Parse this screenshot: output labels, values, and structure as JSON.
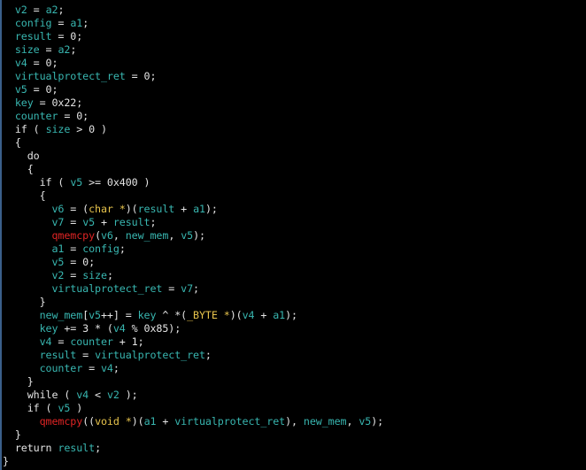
{
  "colors": {
    "identifier": "#38b6b0",
    "plain": "#e4e4e4",
    "type": "#e8c44c",
    "function": "#e02424",
    "background": "#000000"
  },
  "code_lines": [
    [
      [
        "p",
        "  "
      ],
      [
        "v",
        "v2"
      ],
      [
        "p",
        " = "
      ],
      [
        "v",
        "a2"
      ],
      [
        "p",
        ";"
      ]
    ],
    [
      [
        "p",
        "  "
      ],
      [
        "v",
        "config"
      ],
      [
        "p",
        " = "
      ],
      [
        "v",
        "a1"
      ],
      [
        "p",
        ";"
      ]
    ],
    [
      [
        "p",
        "  "
      ],
      [
        "v",
        "result"
      ],
      [
        "p",
        " = 0;"
      ]
    ],
    [
      [
        "p",
        "  "
      ],
      [
        "v",
        "size"
      ],
      [
        "p",
        " = "
      ],
      [
        "v",
        "a2"
      ],
      [
        "p",
        ";"
      ]
    ],
    [
      [
        "p",
        "  "
      ],
      [
        "v",
        "v4"
      ],
      [
        "p",
        " = 0;"
      ]
    ],
    [
      [
        "p",
        "  "
      ],
      [
        "v",
        "virtualprotect_ret"
      ],
      [
        "p",
        " = 0;"
      ]
    ],
    [
      [
        "p",
        "  "
      ],
      [
        "v",
        "v5"
      ],
      [
        "p",
        " = 0;"
      ]
    ],
    [
      [
        "p",
        "  "
      ],
      [
        "v",
        "key"
      ],
      [
        "p",
        " = 0x22;"
      ]
    ],
    [
      [
        "p",
        "  "
      ],
      [
        "v",
        "counter"
      ],
      [
        "p",
        " = 0;"
      ]
    ],
    [
      [
        "p",
        "  if ( "
      ],
      [
        "v",
        "size"
      ],
      [
        "p",
        " > 0 )"
      ]
    ],
    [
      [
        "p",
        "  {"
      ]
    ],
    [
      [
        "p",
        "    do"
      ]
    ],
    [
      [
        "p",
        "    {"
      ]
    ],
    [
      [
        "p",
        "      if ( "
      ],
      [
        "v",
        "v5"
      ],
      [
        "p",
        " >= 0x400 )"
      ]
    ],
    [
      [
        "p",
        "      {"
      ]
    ],
    [
      [
        "p",
        "        "
      ],
      [
        "v",
        "v6"
      ],
      [
        "p",
        " = ("
      ],
      [
        "t",
        "char *"
      ],
      [
        "p",
        ")("
      ],
      [
        "v",
        "result"
      ],
      [
        "p",
        " + "
      ],
      [
        "v",
        "a1"
      ],
      [
        "p",
        ");"
      ]
    ],
    [
      [
        "p",
        "        "
      ],
      [
        "v",
        "v7"
      ],
      [
        "p",
        " = "
      ],
      [
        "v",
        "v5"
      ],
      [
        "p",
        " + "
      ],
      [
        "v",
        "result"
      ],
      [
        "p",
        ";"
      ]
    ],
    [
      [
        "p",
        "        "
      ],
      [
        "f",
        "qmemcpy"
      ],
      [
        "p",
        "("
      ],
      [
        "v",
        "v6"
      ],
      [
        "p",
        ", "
      ],
      [
        "v",
        "new_mem"
      ],
      [
        "p",
        ", "
      ],
      [
        "v",
        "v5"
      ],
      [
        "p",
        ");"
      ]
    ],
    [
      [
        "p",
        "        "
      ],
      [
        "v",
        "a1"
      ],
      [
        "p",
        " = "
      ],
      [
        "v",
        "config"
      ],
      [
        "p",
        ";"
      ]
    ],
    [
      [
        "p",
        "        "
      ],
      [
        "v",
        "v5"
      ],
      [
        "p",
        " = 0;"
      ]
    ],
    [
      [
        "p",
        "        "
      ],
      [
        "v",
        "v2"
      ],
      [
        "p",
        " = "
      ],
      [
        "v",
        "size"
      ],
      [
        "p",
        ";"
      ]
    ],
    [
      [
        "p",
        "        "
      ],
      [
        "v",
        "virtualprotect_ret"
      ],
      [
        "p",
        " = "
      ],
      [
        "v",
        "v7"
      ],
      [
        "p",
        ";"
      ]
    ],
    [
      [
        "p",
        "      }"
      ]
    ],
    [
      [
        "p",
        "      "
      ],
      [
        "v",
        "new_mem"
      ],
      [
        "p",
        "["
      ],
      [
        "v",
        "v5"
      ],
      [
        "p",
        "++] = "
      ],
      [
        "v",
        "key"
      ],
      [
        "p",
        " ^ *("
      ],
      [
        "t",
        "_BYTE *"
      ],
      [
        "p",
        ")("
      ],
      [
        "v",
        "v4"
      ],
      [
        "p",
        " + "
      ],
      [
        "v",
        "a1"
      ],
      [
        "p",
        ");"
      ]
    ],
    [
      [
        "p",
        "      "
      ],
      [
        "v",
        "key"
      ],
      [
        "p",
        " += 3 * ("
      ],
      [
        "v",
        "v4"
      ],
      [
        "p",
        " % 0x85);"
      ]
    ],
    [
      [
        "p",
        "      "
      ],
      [
        "v",
        "v4"
      ],
      [
        "p",
        " = "
      ],
      [
        "v",
        "counter"
      ],
      [
        "p",
        " + 1;"
      ]
    ],
    [
      [
        "p",
        "      "
      ],
      [
        "v",
        "result"
      ],
      [
        "p",
        " = "
      ],
      [
        "v",
        "virtualprotect_ret"
      ],
      [
        "p",
        ";"
      ]
    ],
    [
      [
        "p",
        "      "
      ],
      [
        "v",
        "counter"
      ],
      [
        "p",
        " = "
      ],
      [
        "v",
        "v4"
      ],
      [
        "p",
        ";"
      ]
    ],
    [
      [
        "p",
        "    }"
      ]
    ],
    [
      [
        "p",
        "    while ( "
      ],
      [
        "v",
        "v4"
      ],
      [
        "p",
        " < "
      ],
      [
        "v",
        "v2"
      ],
      [
        "p",
        " );"
      ]
    ],
    [
      [
        "p",
        "    if ( "
      ],
      [
        "v",
        "v5"
      ],
      [
        "p",
        " )"
      ]
    ],
    [
      [
        "p",
        "      "
      ],
      [
        "f",
        "qmemcpy"
      ],
      [
        "p",
        "(("
      ],
      [
        "t",
        "void *"
      ],
      [
        "p",
        ")("
      ],
      [
        "v",
        "a1"
      ],
      [
        "p",
        " + "
      ],
      [
        "v",
        "virtualprotect_ret"
      ],
      [
        "p",
        "), "
      ],
      [
        "v",
        "new_mem"
      ],
      [
        "p",
        ", "
      ],
      [
        "v",
        "v5"
      ],
      [
        "p",
        ");"
      ]
    ],
    [
      [
        "p",
        "  }"
      ]
    ],
    [
      [
        "p",
        "  return "
      ],
      [
        "v",
        "result"
      ],
      [
        "p",
        ";"
      ]
    ],
    [
      [
        "p",
        "}"
      ]
    ]
  ]
}
